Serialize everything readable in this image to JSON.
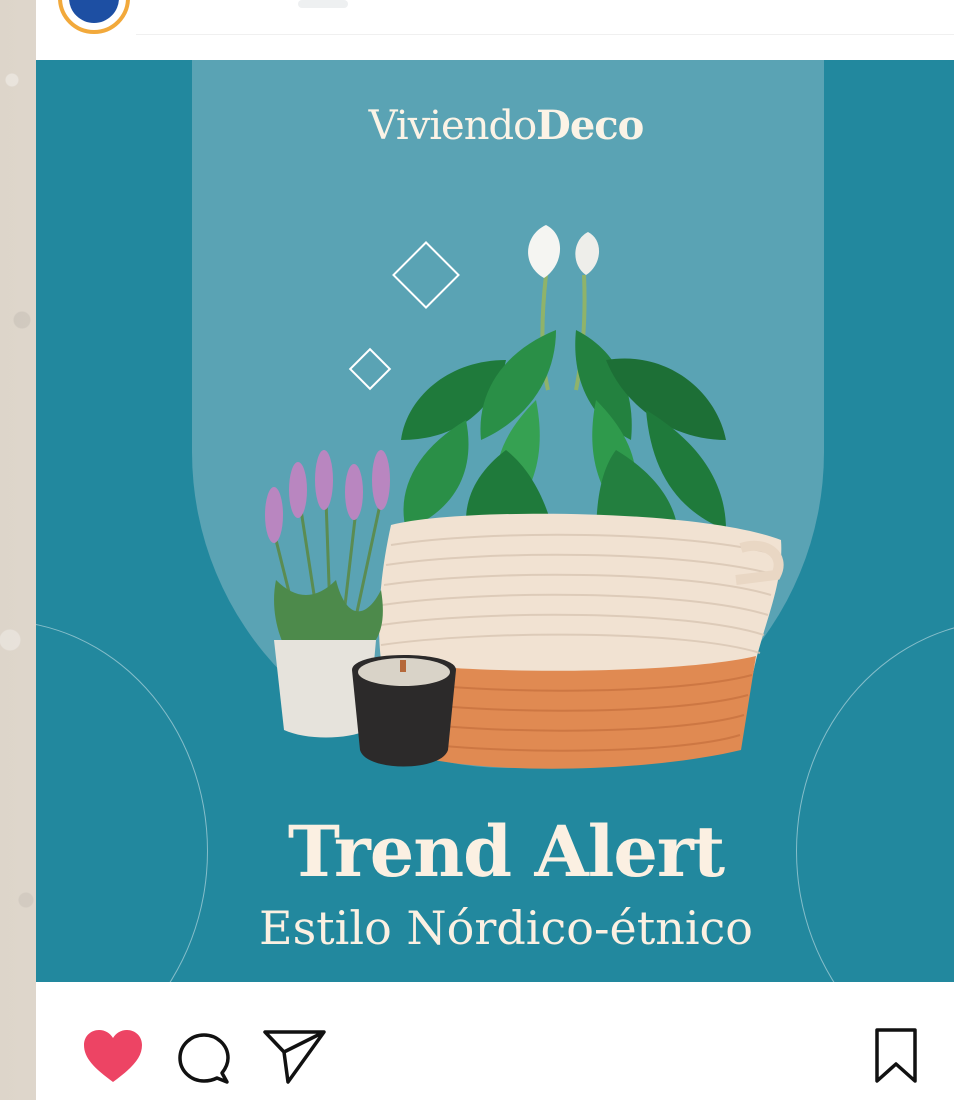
{
  "post": {
    "brand_regular": "Viviendo",
    "brand_bold": "Deco",
    "headline": "Trend Alert",
    "subheadline": "Estilo Nórdico-étnico"
  },
  "actions": {
    "like_icon": "heart-filled-icon",
    "comment_icon": "comment-bubble-icon",
    "share_icon": "paper-plane-icon",
    "save_icon": "bookmark-icon",
    "like_color": "#ed4464"
  },
  "colors": {
    "post_background": "#22889e",
    "arch": "#5aa3b4",
    "text_cream": "#fbf0e2"
  }
}
